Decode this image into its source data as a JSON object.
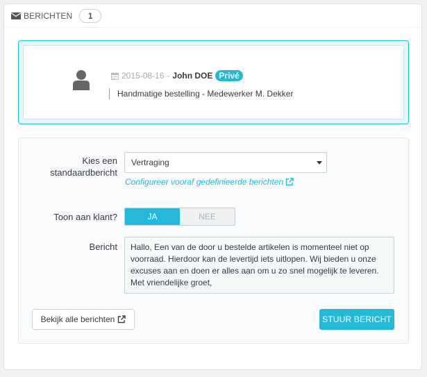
{
  "heading": {
    "title": "BERICHTEN",
    "count": "1"
  },
  "message": {
    "date": "2015-08-16",
    "date_separator": "-",
    "author": "John DOE",
    "badge": "Privé",
    "text": "Handmatige bestelling - Medewerker M. Dekker"
  },
  "form": {
    "template_label": "Kies een standaardbericht",
    "template_selected": "Vertraging",
    "config_link": "Configureer vooraf gedefinieerde berichten",
    "show_customer_label": "Toon aan klant?",
    "toggle_yes": "JA",
    "toggle_no": "NEE",
    "toggle_value": "JA",
    "message_label": "Bericht",
    "message_value": "Hallo, Een van de door u bestelde artikelen is momenteel niet op voorraad. Hierdoor kan de levertijd iets uitlopen. Wij bieden u onze excuses aan en doen er alles aan om u zo snel mogelijk te leveren. Met vriendelijke groet,",
    "view_all_button": "Bekijk alle berichten",
    "send_button": "STUUR BERICHT"
  },
  "colors": {
    "accent": "#25b9d7",
    "message_box_bg": "#dff6fb"
  },
  "icons": [
    "envelope-icon",
    "user-icon",
    "calendar-icon",
    "external-link-icon"
  ]
}
